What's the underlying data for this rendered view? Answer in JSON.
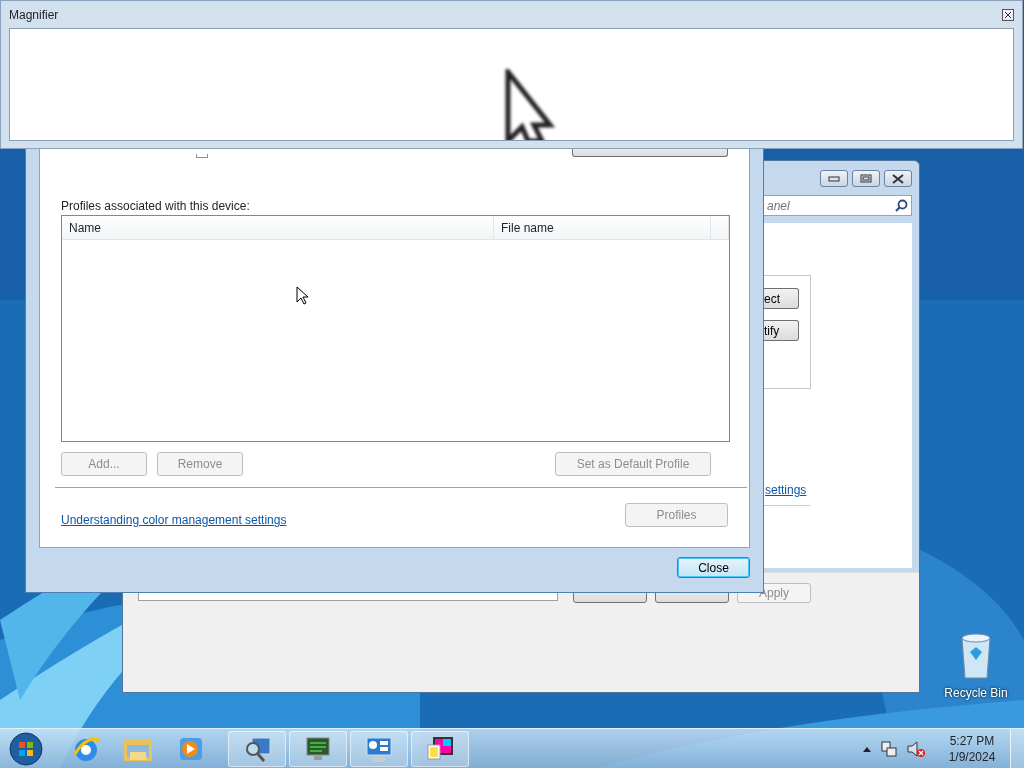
{
  "magnifier": {
    "title": "Magnifier"
  },
  "color_dialog": {
    "profiles_label": "Profiles associated with this device:",
    "columns": [
      "Name",
      "File name"
    ],
    "list_buttons": [
      {
        "label": "Add...",
        "disabled": true
      },
      {
        "label": "Remove",
        "disabled": true
      },
      {
        "label": "Set as Default Profile",
        "disabled": true
      }
    ],
    "link": "Understanding color management settings",
    "profiles_button": {
      "label": "Profiles",
      "disabled": true
    },
    "close_button": {
      "label": "Close",
      "disabled": false
    }
  },
  "background_window": {
    "search": {
      "placeholder": "anel"
    },
    "group_buttons": [
      {
        "label": "ect",
        "disabled": false
      },
      {
        "label": "tify",
        "disabled": false
      }
    ],
    "link": "settings",
    "apply_button": {
      "label": "Apply",
      "disabled": true
    }
  },
  "desktop_icons": [
    {
      "label": "Recycle Bin"
    }
  ],
  "taskbar": {
    "time": "5:27 PM",
    "date": "1/9/2024"
  }
}
